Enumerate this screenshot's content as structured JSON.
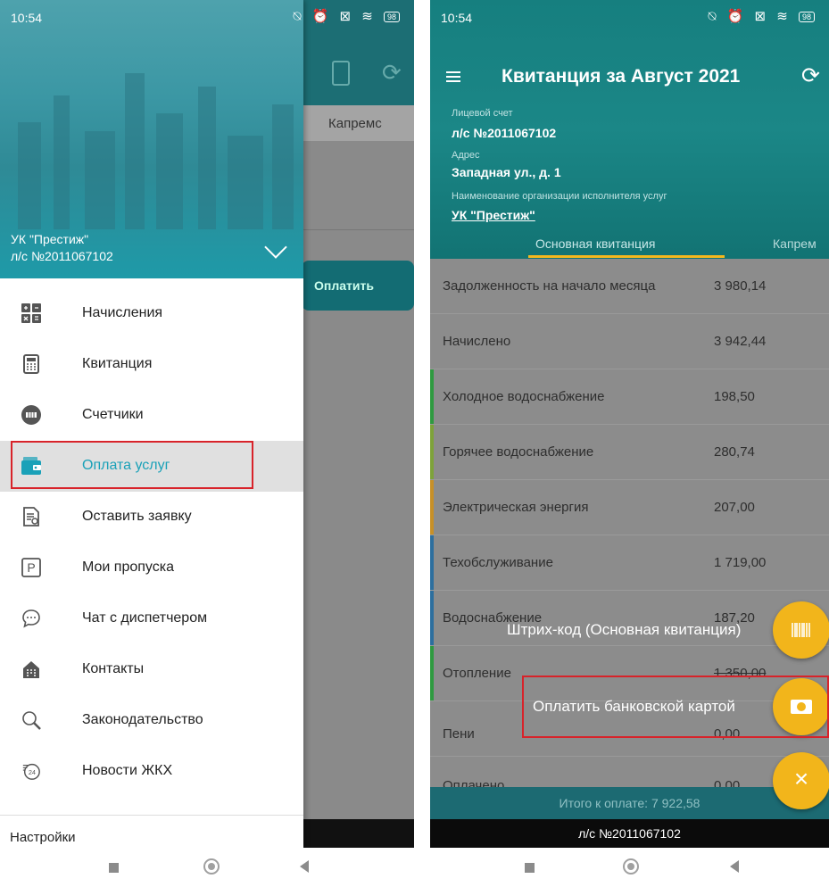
{
  "left_screen": {
    "status": {
      "time": "10:54",
      "battery": "98"
    },
    "behind": {
      "tab_partial": "Капремс",
      "pay_button": "Оплатить"
    },
    "drawer": {
      "org": "УК \"Престиж\"",
      "account": "л/с №2011067102",
      "items": [
        {
          "label": "Начисления",
          "icon": "calculator-icon"
        },
        {
          "label": "Квитанция",
          "icon": "receipt-icon"
        },
        {
          "label": "Счетчики",
          "icon": "meter-icon"
        },
        {
          "label": "Оплата услуг",
          "icon": "wallet-icon"
        },
        {
          "label": "Оставить заявку",
          "icon": "request-icon"
        },
        {
          "label": "Мои пропуска",
          "icon": "parking-icon"
        },
        {
          "label": "Чат с диспетчером",
          "icon": "chat-icon"
        },
        {
          "label": "Контакты",
          "icon": "building-icon"
        },
        {
          "label": "Законодательство",
          "icon": "search-icon"
        },
        {
          "label": "Новости ЖКХ",
          "icon": "news-24-icon"
        }
      ],
      "active_item": "Оплата услуг",
      "settings": "Настройки"
    }
  },
  "right_screen": {
    "status": {
      "time": "10:54",
      "battery": "98"
    },
    "title": "Квитанция за Август 2021",
    "account_label": "Лицевой счет",
    "account_value": "л/с №2011067102",
    "address_label": "Адрес",
    "address_value": "Западная ул., д. 1",
    "org_label": "Наименование организации исполнителя услуг",
    "org_value": "УК \"Престиж\"",
    "tabs": [
      "Основная квитанция",
      "Капрем"
    ],
    "rows": [
      {
        "name": "Задолженность на начало месяца",
        "value": "3 980,14"
      },
      {
        "name": "Начислено",
        "value": "3 942,44"
      },
      {
        "name": "Холодное водоснабжение",
        "value": "198,50"
      },
      {
        "name": "Горячее водоснабжение",
        "value": "280,74"
      },
      {
        "name": "Электрическая энергия",
        "value": "207,00"
      },
      {
        "name": "Техобслуживание",
        "value": "1 719,00"
      },
      {
        "name": "Водоснабжение",
        "value": "187,20"
      },
      {
        "name": "Отопление",
        "value": "1 350,00"
      },
      {
        "name": "Пени",
        "value": "0,00"
      },
      {
        "name": "Оплачено",
        "value": "0,00"
      }
    ],
    "fab_barcode_label": "Штрих-код (Основная квитанция)",
    "fab_card_label": "Оплатить банковской картой",
    "fab_close": "×",
    "total": "Итого к оплате: 7 922,58",
    "account_footer": "л/с №2011067102",
    "colors": {
      "teal": "#167f7f",
      "accent": "#f2b51b",
      "highlight": "#d8232a"
    }
  }
}
